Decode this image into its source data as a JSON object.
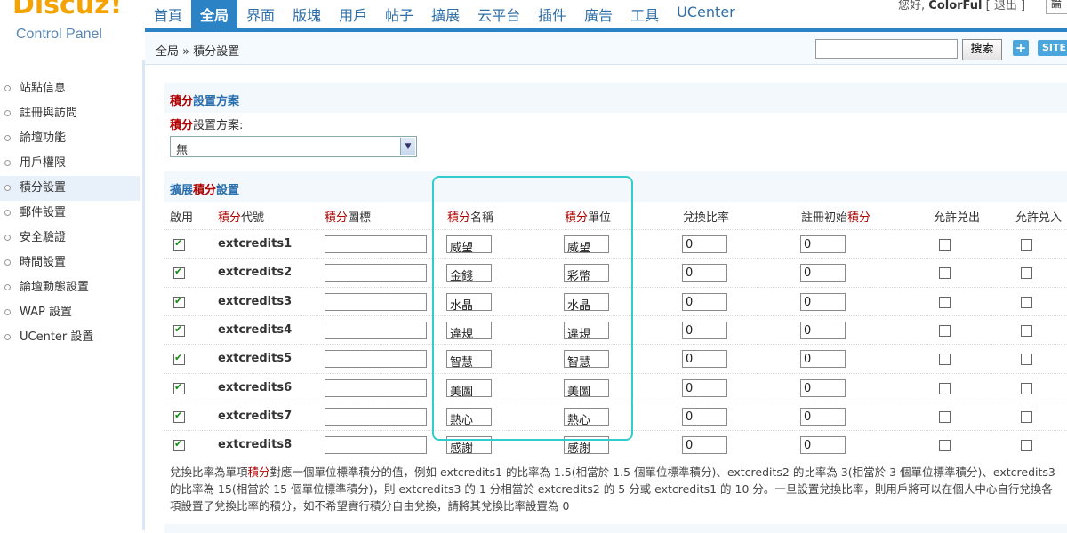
{
  "logo": {
    "main": "Discuz!",
    "sub": "Control Panel"
  },
  "nav": [
    "首頁",
    "全局",
    "界面",
    "版塊",
    "用戶",
    "帖子",
    "擴展",
    "云平台",
    "插件",
    "廣告",
    "工具",
    "UCenter"
  ],
  "nav_active": 1,
  "user": {
    "greeting": "您好,",
    "name": "ColorFul",
    "logout": "[ 退出 ]",
    "box": "論"
  },
  "breadcrumb": "全局 » 積分設置",
  "search": {
    "button": "搜索",
    "value": ""
  },
  "header_buttons": {
    "plus": "+",
    "site": "SITE"
  },
  "sidebar": [
    "站點信息",
    "註冊與訪問",
    "論壇功能",
    "用戶權限",
    "積分設置",
    "郵件設置",
    "安全驗證",
    "時間設置",
    "論壇動態設置",
    "WAP 設置",
    "UCenter 設置"
  ],
  "sidebar_active": 4,
  "scheme_section": {
    "title_red": "積分",
    "title_rest": "設置方案",
    "label_red": "積分",
    "label_rest": "設置方案:",
    "selected": "無"
  },
  "ext_section": {
    "title_a": "擴展",
    "title_red": "積分",
    "title_b": "設置"
  },
  "columns": {
    "enable": "啟用",
    "code_red": "積分",
    "code": "代號",
    "icon_red": "積分",
    "icon": "圖標",
    "name_red": "積分",
    "name": "名稱",
    "unit_red": "積分",
    "unit": "單位",
    "ratio": "兌換比率",
    "init": "註冊初始",
    "init_red": "積分",
    "out": "允許兑出",
    "in": "允許兑入"
  },
  "rows": [
    {
      "enabled": true,
      "code": "extcredits1",
      "icon": "",
      "name": "威望",
      "unit": "威望",
      "ratio": "0",
      "init": "0",
      "out": false,
      "in": false
    },
    {
      "enabled": true,
      "code": "extcredits2",
      "icon": "",
      "name": "金錢",
      "unit": "彩幣",
      "ratio": "0",
      "init": "0",
      "out": false,
      "in": false
    },
    {
      "enabled": true,
      "code": "extcredits3",
      "icon": "",
      "name": "水晶",
      "unit": "水晶",
      "ratio": "0",
      "init": "0",
      "out": false,
      "in": false
    },
    {
      "enabled": true,
      "code": "extcredits4",
      "icon": "",
      "name": "違規",
      "unit": "違規",
      "ratio": "0",
      "init": "0",
      "out": false,
      "in": false
    },
    {
      "enabled": true,
      "code": "extcredits5",
      "icon": "",
      "name": "智慧",
      "unit": "智慧",
      "ratio": "0",
      "init": "0",
      "out": false,
      "in": false
    },
    {
      "enabled": true,
      "code": "extcredits6",
      "icon": "",
      "name": "美圖",
      "unit": "美圖",
      "ratio": "0",
      "init": "0",
      "out": false,
      "in": false
    },
    {
      "enabled": true,
      "code": "extcredits7",
      "icon": "",
      "name": "熱心",
      "unit": "熱心",
      "ratio": "0",
      "init": "0",
      "out": false,
      "in": false
    },
    {
      "enabled": true,
      "code": "extcredits8",
      "icon": "",
      "name": "感謝",
      "unit": "感謝",
      "ratio": "0",
      "init": "0",
      "out": false,
      "in": false
    }
  ],
  "note": {
    "a": "兌換比率為單項",
    "red": "積分",
    "b": "對應一個單位標準積分的值，例如 extcredits1 的比率為 1.5(相當於 1.5 個單位標準積分)、extcredits2 的比率為 3(相當於 3 個單位標準積分)、extcredits3 的比率為 15(相當於 15 個單位標準積分)，則 extcredits3 的 1 分相當於 extcredits2 的 5 分或 extcredits1 的 10 分。一旦設置兌換比率，則用戶將可以在個人中心自行兌換各項設置了兌換比率的積分，如不希望實行積分自由兌換，請將其兌換比率設置為 0"
  },
  "colors": {
    "accent": "#2b82c5",
    "red": "#b00000",
    "highlight": "#33cccc"
  }
}
